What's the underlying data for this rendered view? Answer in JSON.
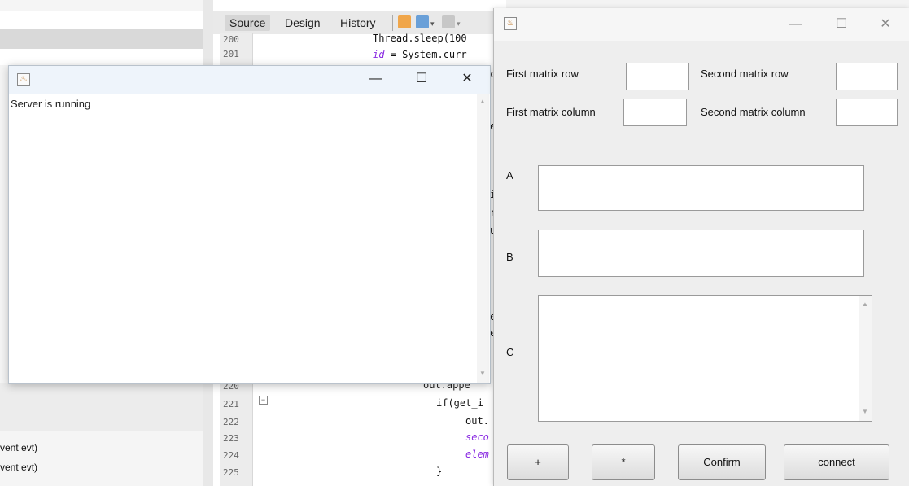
{
  "ide": {
    "event_lines": [
      "vent evt)",
      "vent evt)"
    ],
    "tabs": [
      "Source",
      "Design",
      "History"
    ],
    "line_numbers": [
      "200",
      "201",
      "220",
      "221",
      "222",
      "223",
      "224",
      "225"
    ],
    "code_lines": {
      "l200": "Thread.sleep(100",
      "l201a": "id",
      "l201b": " = System.curr",
      "l220": "out.appe",
      "l221": "if(get_i",
      "l222": "out.",
      "l223": "seco",
      "l224": "elem",
      "l225": "}"
    },
    "code_fragments": [
      "c",
      "e",
      "i",
      "r",
      "u",
      "e",
      "e"
    ]
  },
  "server_window": {
    "text": "Server is running",
    "controls": {
      "minimize": "—",
      "maximize": "☐",
      "close": "✕"
    }
  },
  "matrix_window": {
    "controls": {
      "minimize": "—",
      "maximize": "☐",
      "close": "✕"
    },
    "labels": {
      "first_row": "First matrix row",
      "second_row": "Second matrix row",
      "first_col": "First matrix column",
      "second_col": "Second matrix column",
      "a": "A",
      "b": "B",
      "c": "C"
    },
    "inputs": {
      "first_row": "",
      "second_row": "",
      "first_col": "",
      "second_col": "",
      "a": "",
      "b": "",
      "c": ""
    },
    "buttons": {
      "plus": "+",
      "multiply": "*",
      "confirm": "Confirm",
      "connect": "connect"
    }
  }
}
